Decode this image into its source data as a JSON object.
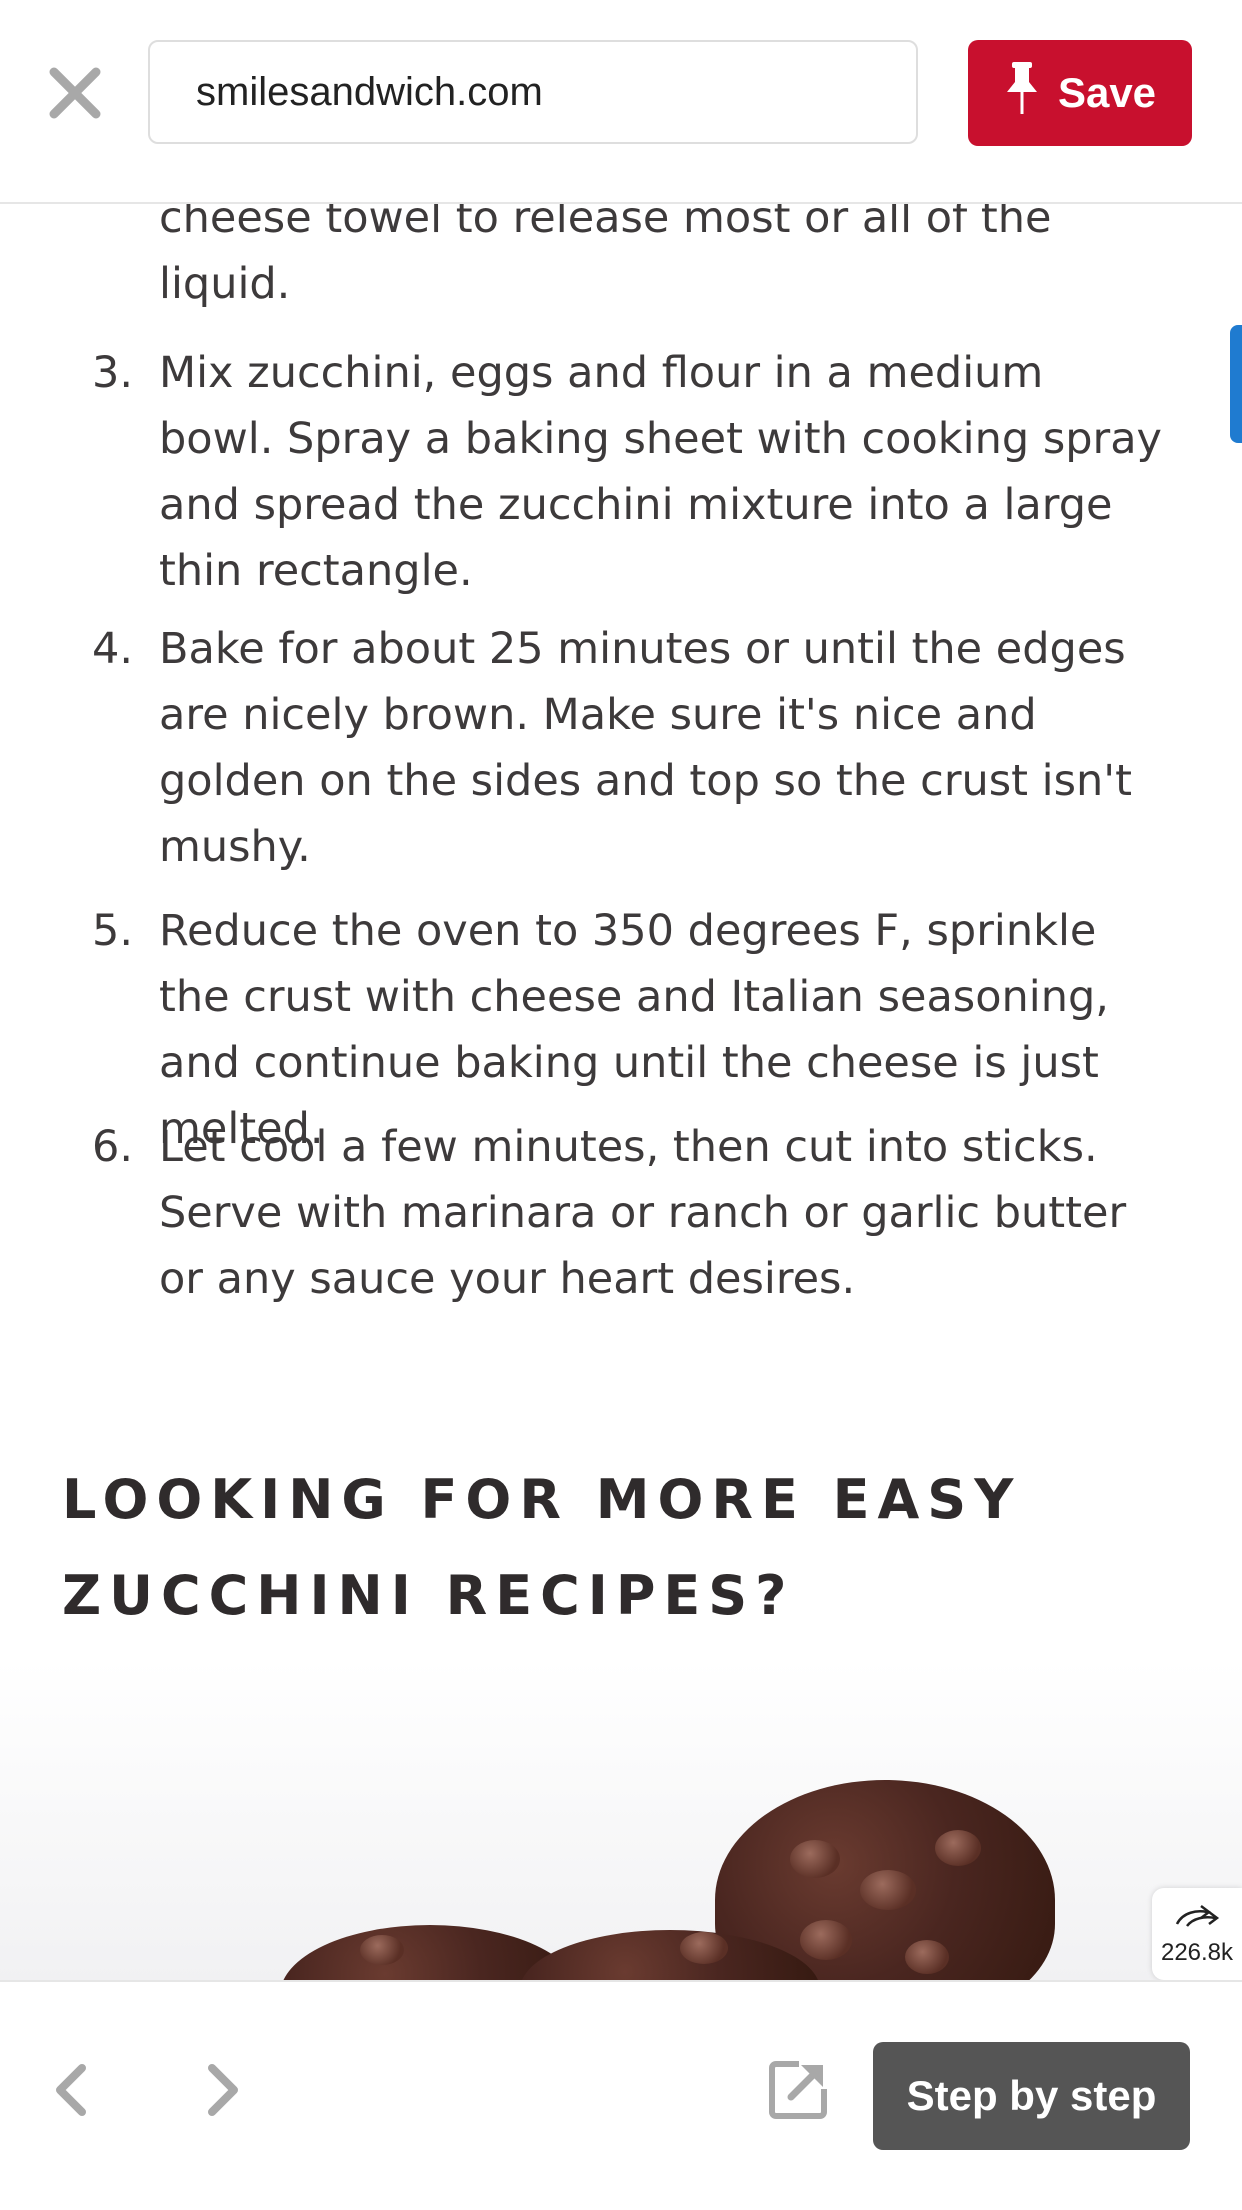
{
  "header": {
    "url": "smilesandwich.com",
    "save_label": "Save",
    "save_color": "#c8102e"
  },
  "content": {
    "partial_step_text": "cheese towel to release most or all of the liquid.",
    "steps": [
      {
        "number": "3.",
        "text": "Mix zucchini, eggs and flour in a medium bowl. Spray a baking sheet with cooking spray and spread the zucchini mixture into a large thin rectangle."
      },
      {
        "number": "4.",
        "text": "Bake for about 25 minutes or until the edges are nicely brown. Make sure it's nice and golden on the sides and top so the crust isn't mushy."
      },
      {
        "number": "5.",
        "text": "Reduce the oven to 350 degrees F, sprinkle the crust with cheese and Italian seasoning, and continue baking until the cheese is just melted."
      },
      {
        "number": "6.",
        "text": "Let cool a few minutes, then cut into sticks. Serve with marinara or ranch or garlic butter or any sauce your heart desires."
      }
    ],
    "section_heading": "LOOKING FOR MORE EASY ZUCCHINI RECIPES?"
  },
  "share": {
    "count": "226.8k",
    "icon": "share-arrow-icon"
  },
  "footer": {
    "step_by_step_label": "Step by step",
    "button_color": "#555555"
  }
}
